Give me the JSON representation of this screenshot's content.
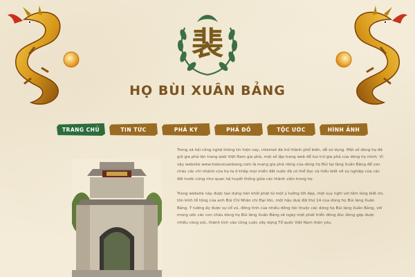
{
  "brand": {
    "logo_char": "裴",
    "name": "HỌ BÙI XUÂN BẢNG"
  },
  "nav": {
    "items": [
      {
        "label": "TRANG CHỦ",
        "active": true
      },
      {
        "label": "TIN TỨC",
        "active": false
      },
      {
        "label": "PHẢ KÝ",
        "active": false
      },
      {
        "label": "PHẢ ĐỒ",
        "active": false
      },
      {
        "label": "TỘC ƯỚC",
        "active": false
      },
      {
        "label": "HÌNH ẢNH",
        "active": false
      }
    ]
  },
  "intro": {
    "paragraph_1": "Trong xã hội công nghệ thông tin hiện nay, internet đã trở thành phổ biến, dễ sử dụng. Một số dòng họ đã gửi gia phả lên trang web Việt Nam gia phả, một số lập trang web để lưu trữ gia phả của dòng họ mình. Vì vậy website www.hobuixuanbang.com là mang gia phả riêng của dòng họ Bùi tại làng Xuân Bảng để con cháu các chi nhánh của họ ta ở khắp mọi miền đất nước đã có thể đọc và hiểu biết về sự nghiệp của các đời trước cũng như quan hệ huyết thống giữa các thành viên trong họ.",
    "paragraph_2": "Trang website này được tạo dựng nên khởi phát từ một ý tưởng tốt đẹp, một suy nghĩ với tấm lòng biết ơn, tôn kính tổ tông của anh Bùi Chí Nhân chi Đại tôn, một hậu duệ đời thứ 14 của dòng họ Bùi làng Xuân Bảng. Ý tưởng ấy được sự cổ vũ, đồng tình của nhiều đồng tộc thuộc các dòng họ Bùi làng Xuân Bảng, với mong ước các con cháu dòng họ Bùi làng Xuân Bảng sẽ ngày một phát triển đông đúc đóng góp được nhiều công sức, thành tích vào công cuộc xây dựng Tổ quốc Việt Nam thân yêu."
  },
  "colors": {
    "accent_green": "#2d6c3c",
    "accent_gold": "#9a6b22",
    "background": "#f4ecd9"
  },
  "icons": {
    "left_decoration": "golden-dragon-icon",
    "right_decoration": "golden-dragon-icon",
    "logo": "clan-emblem-icon",
    "photo": "ancestral-gate-photo"
  }
}
